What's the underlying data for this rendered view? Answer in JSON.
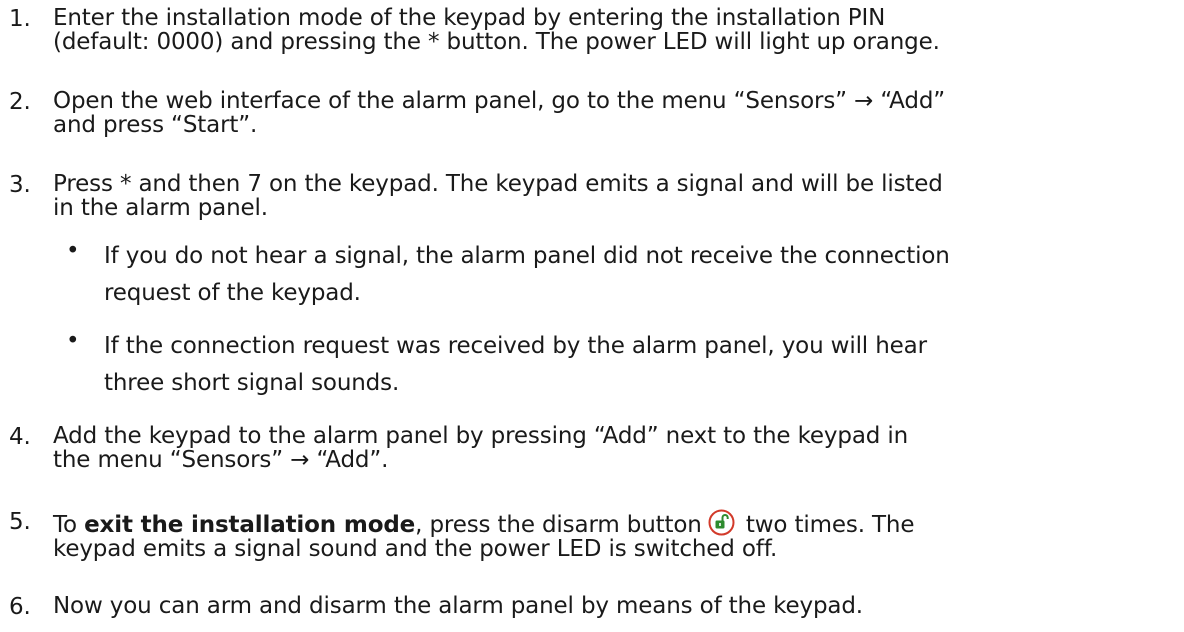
{
  "steps": [
    {
      "num": "1.",
      "lines": [
        "Enter the installation mode of the keypad by entering the installation PIN",
        "(default: 0000) and pressing the * button. The power LED will light up orange."
      ]
    },
    {
      "num": "2.",
      "lines": [
        "Open the web interface of the alarm panel, go to the menu “Sensors” → “Add”",
        "and press “Start”."
      ]
    },
    {
      "num": "3.",
      "lines": [
        "Press * and then 7 on the keypad. The keypad emits a signal and will be listed",
        "in the alarm panel."
      ],
      "bullets": [
        {
          "lines": [
            "If you do not hear a signal, the alarm panel did not receive the connection",
            "request of the keypad."
          ]
        },
        {
          "lines": [
            "If the connection request was received by the alarm panel, you will hear",
            "three short signal sounds."
          ]
        }
      ]
    },
    {
      "num": "4.",
      "lines": [
        "Add the keypad to the alarm panel by pressing “Add” next to the keypad in",
        "the menu “Sensors” → “Add”."
      ]
    },
    {
      "num": "5.",
      "prefix": "To ",
      "bold": "exit the installation mode",
      "mid": ", press the disarm button",
      "after_icon": " two times. The",
      "line2": "keypad emits a signal sound and the power LED is switched off.",
      "icon": "unlock-icon",
      "icon_color": "#2e8b2e"
    },
    {
      "num": "6.",
      "lines": [
        "Now you can arm and disarm the alarm panel by means of the keypad."
      ]
    }
  ]
}
